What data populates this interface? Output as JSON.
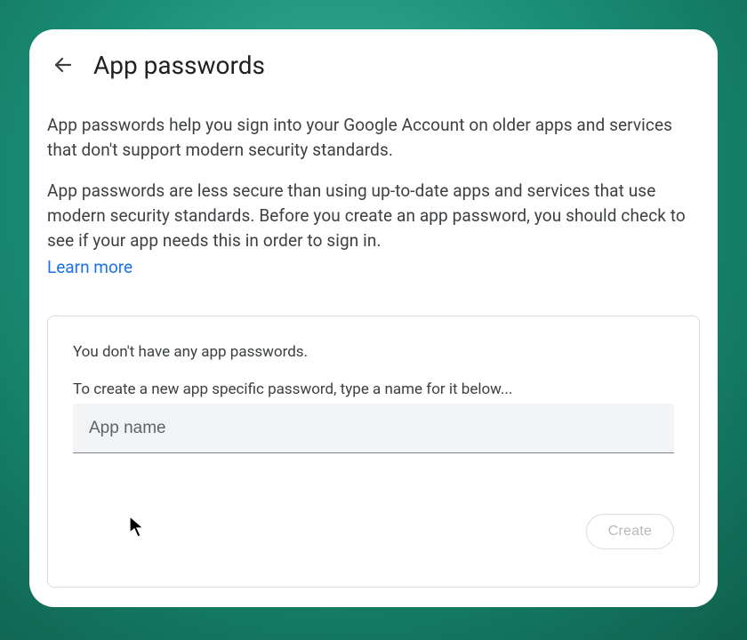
{
  "header": {
    "title": "App passwords"
  },
  "intro": {
    "para1": "App passwords help you sign into your Google Account on older apps and services that don't support modern security standards.",
    "para2": "App passwords are less secure than using up-to-date apps and services that use modern security standards. Before you create an app password, you should check to see if your app needs this in order to sign in.",
    "learn_more": "Learn more"
  },
  "panel": {
    "empty_msg": "You don't have any app passwords.",
    "instruction": "To create a new app specific password, type a name for it below...",
    "input_placeholder": "App name",
    "input_value": "",
    "create_label": "Create"
  }
}
